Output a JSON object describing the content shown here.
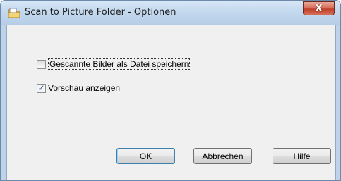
{
  "window": {
    "title": "Scan to Picture Folder - Optionen",
    "close_label": "X"
  },
  "options": {
    "save_as_file": {
      "label": "Gescannte Bilder als Datei speichern",
      "checked": false
    },
    "show_preview": {
      "label": "Vorschau anzeigen",
      "checked": true
    }
  },
  "buttons": {
    "ok": "OK",
    "cancel": "Abbrechen",
    "help": "Hilfe"
  },
  "colors": {
    "titlebar": "#c4d9ee",
    "client": "#f0f0f0",
    "close": "#c0402a"
  }
}
